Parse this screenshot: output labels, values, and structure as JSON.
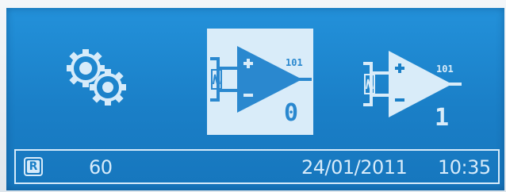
{
  "display": {
    "screen_color": "#1a7fc7",
    "foreground_color": "#d6ebfa",
    "selected_highlight_color": "#d9ecf9"
  },
  "menu": {
    "items": [
      {
        "icon": "gears-settings-icon",
        "selected": false
      },
      {
        "icon": "amplifier-output-icon",
        "bits_label": "101",
        "number": "0",
        "selected": true
      },
      {
        "icon": "amplifier-output-icon",
        "bits_label": "101",
        "number": "1",
        "selected": false
      }
    ]
  },
  "status_bar": {
    "mode_badge": "R",
    "value": "60",
    "date": "24/01/2011",
    "time": "10:35"
  }
}
